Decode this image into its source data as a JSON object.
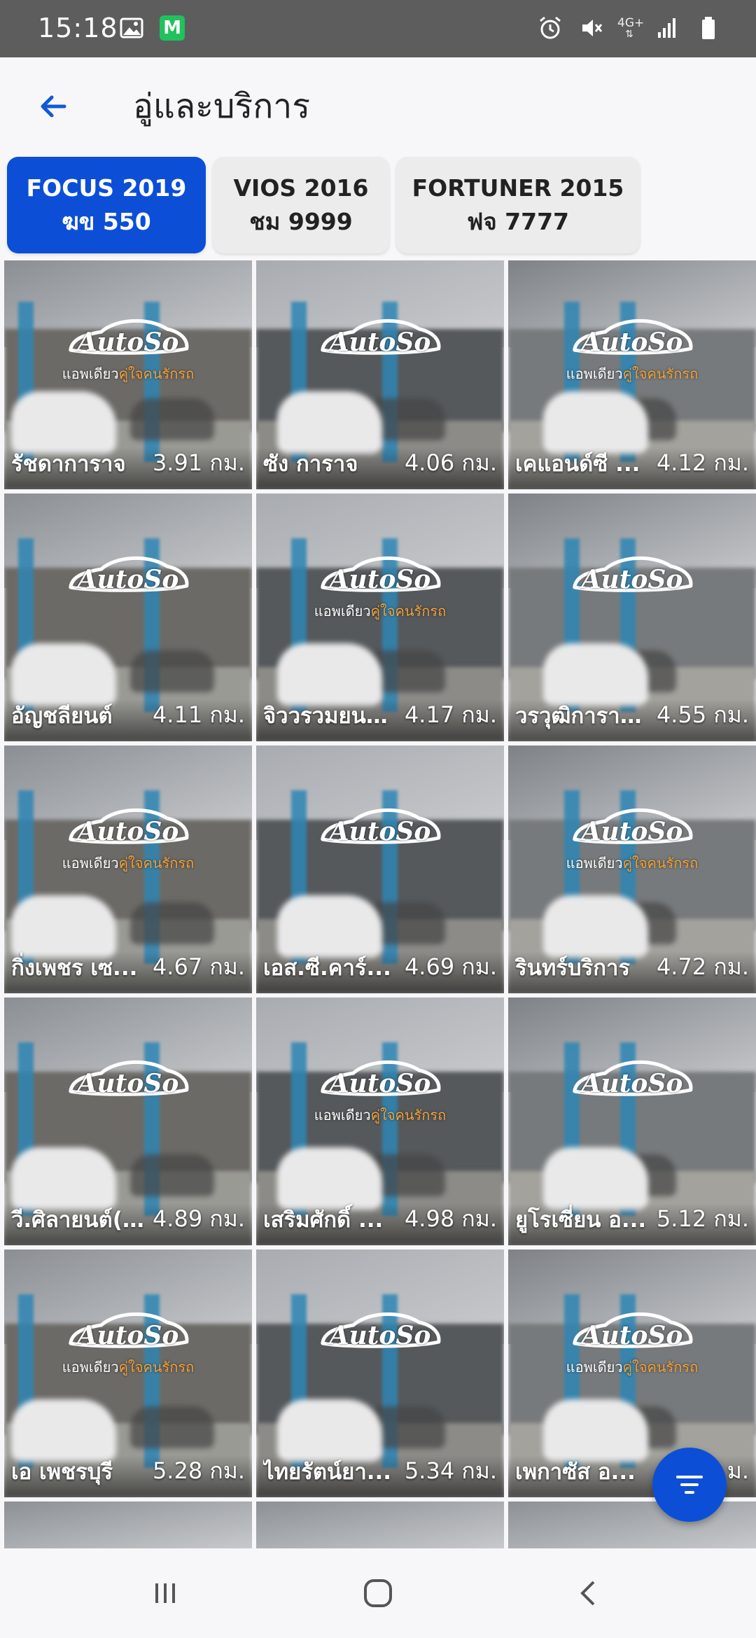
{
  "status_bar": {
    "time": "15:18",
    "left_icons": [
      "image-icon",
      "m-app-icon"
    ],
    "m_app_letter": "M",
    "network_label": "4G+",
    "right_icons": [
      "alarm-icon",
      "mute-icon",
      "network-4g-icon",
      "signal-icon",
      "battery-icon"
    ]
  },
  "header": {
    "title": "อู่และบริการ",
    "back_icon": "arrow-left-icon"
  },
  "vehicle_tabs": [
    {
      "model": "FOCUS 2019",
      "plate": "ฆข 550",
      "active": true
    },
    {
      "model": "VIOS 2016",
      "plate": "ชม 9999",
      "active": false
    },
    {
      "model": "FORTUNER 2015",
      "plate": "ฟจ 7777",
      "active": false
    }
  ],
  "logo": {
    "brand": "AutoSo",
    "tagline_white": "แอพเดียว",
    "tagline_orange": "คู่ใจคนรักรถ"
  },
  "garages": [
    {
      "name": "รัชดาการาจ",
      "distance": "3.91 กม."
    },
    {
      "name": "ซัง การาจ",
      "distance": "4.06 กม."
    },
    {
      "name": "เคแอนด์ซี ...",
      "distance": "4.12 กม."
    },
    {
      "name": "อัญชลียนต์",
      "distance": "4.11 กม."
    },
    {
      "name": "จิววรวมยนต์รุ่...",
      "distance": "4.17 กม."
    },
    {
      "name": "วรวุฒิการาจ...",
      "distance": "4.55 กม."
    },
    {
      "name": "กิ่งเพชร เซ...",
      "distance": "4.67 กม."
    },
    {
      "name": "เอส.ซี.คาร์...",
      "distance": "4.69 กม."
    },
    {
      "name": "รินทร์บริการ",
      "distance": "4.72 กม."
    },
    {
      "name": "วี.ศิลายนต์(...",
      "distance": "4.89 กม."
    },
    {
      "name": "เสริมศักดิ์ ...",
      "distance": "4.98 กม."
    },
    {
      "name": "ยูโรเซี่ยน อ...",
      "distance": "5.12 กม."
    },
    {
      "name": "เอ เพชรบุรี",
      "distance": "5.28 กม."
    },
    {
      "name": "ไทยรัตน์ยา...",
      "distance": "5.34 กม."
    },
    {
      "name": "เพกาซัส อ...",
      "distance": "ม."
    }
  ],
  "fab": {
    "icon": "filter-icon"
  },
  "navbar": {
    "icons": [
      "recent-apps-icon",
      "home-icon",
      "back-icon"
    ]
  }
}
